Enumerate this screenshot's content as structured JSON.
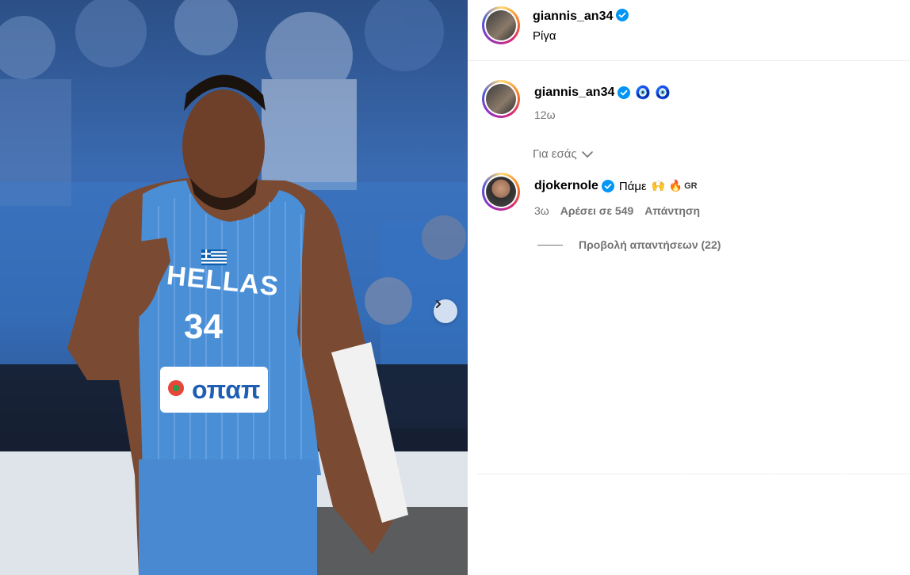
{
  "post": {
    "author": "giannis_an34",
    "location": "Ρίγα",
    "caption_emojis": "🧿 🧿",
    "caption_time": "12ω",
    "jersey": {
      "team_text": "HELLAS",
      "number": "34",
      "sponsor": "οπαπ"
    }
  },
  "comments_section": {
    "sort_label": "Για εσάς",
    "comments": [
      {
        "username": "djokernole",
        "text": "Πάμε",
        "emojis": "🙌 🔥",
        "flag_label": "GR",
        "time": "3ω",
        "likes": "Αρέσει σε 549",
        "reply": "Απάντηση",
        "view_replies": "Προβολή απαντήσεων (22)"
      }
    ]
  },
  "colors": {
    "verified": "#0095f6",
    "muted": "#737373",
    "jersey_blue": "#4a8fd6",
    "divider": "#efefef"
  },
  "icons": [
    "verified-badge-icon",
    "evil-eye-icon",
    "chevron-down-icon",
    "chevron-right-icon"
  ]
}
